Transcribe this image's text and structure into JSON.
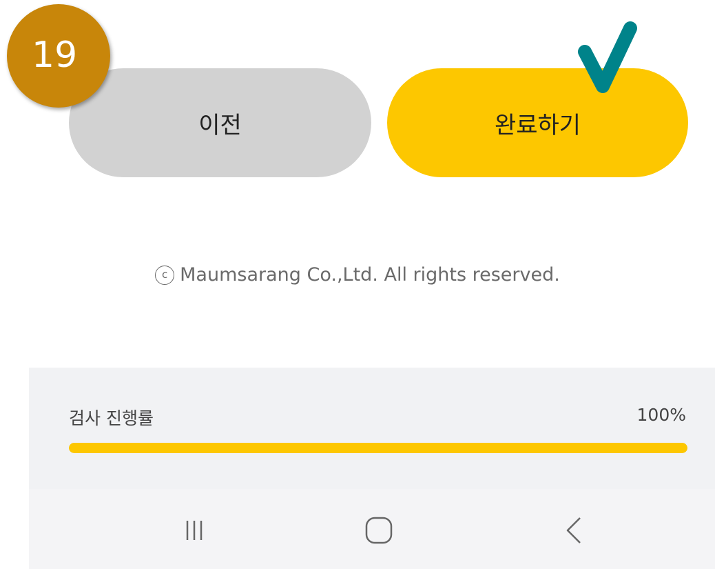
{
  "step_badge": {
    "number": "19"
  },
  "buttons": {
    "prev_label": "이전",
    "complete_label": "완료하기"
  },
  "footer": {
    "copyright_symbol": "c",
    "copyright_text": "Maumsarang Co.,Ltd. All rights reserved."
  },
  "progress": {
    "label": "검사 진행률",
    "percent_text": "100%",
    "value": 1.0
  },
  "colors": {
    "accent": "#fdc700",
    "badge": "#c8860a",
    "check_mark": "#00838a",
    "prev_button": "#d2d2d2"
  },
  "nav": {
    "icons": [
      "recent-apps-icon",
      "home-icon",
      "back-icon"
    ]
  }
}
